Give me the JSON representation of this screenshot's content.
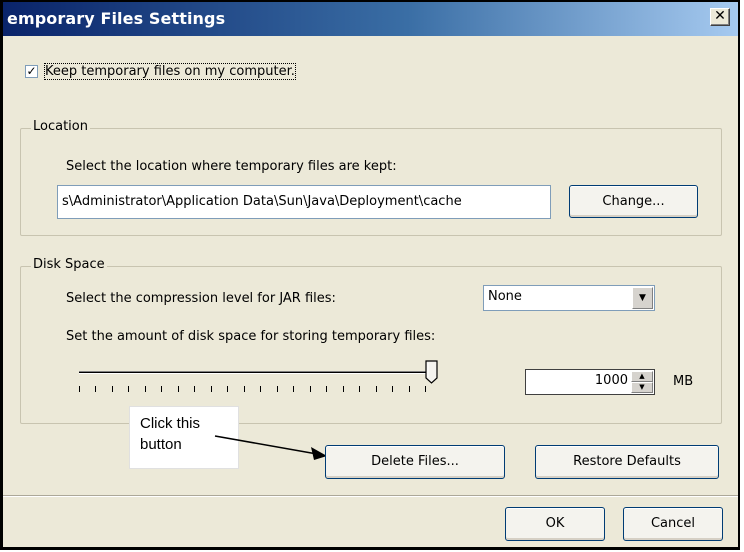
{
  "window": {
    "title": "emporary Files Settings",
    "close_glyph": "✕"
  },
  "keep_files": {
    "checked": true,
    "check_glyph": "✓",
    "label": "Keep temporary files on my computer."
  },
  "location": {
    "legend": "Location",
    "description": "Select the location where temporary files are kept:",
    "path_value": "s\\Administrator\\Application Data\\Sun\\Java\\Deployment\\cache",
    "change_button": "Change..."
  },
  "disk_space": {
    "legend": "Disk Space",
    "compression_label": "Select the compression level for JAR files:",
    "compression_value": "None",
    "compression_arrow": "▼",
    "space_label": "Set the amount of disk space for storing temporary files:",
    "slider_level": 1.0,
    "space_value": "1000",
    "space_unit": "MB",
    "spin_up": "▲",
    "spin_down": "▼"
  },
  "annotation": {
    "line1": "Click this",
    "line2": "button"
  },
  "actions": {
    "delete_files": "Delete Files...",
    "restore_defaults": "Restore Defaults",
    "ok": "OK",
    "cancel": "Cancel"
  }
}
